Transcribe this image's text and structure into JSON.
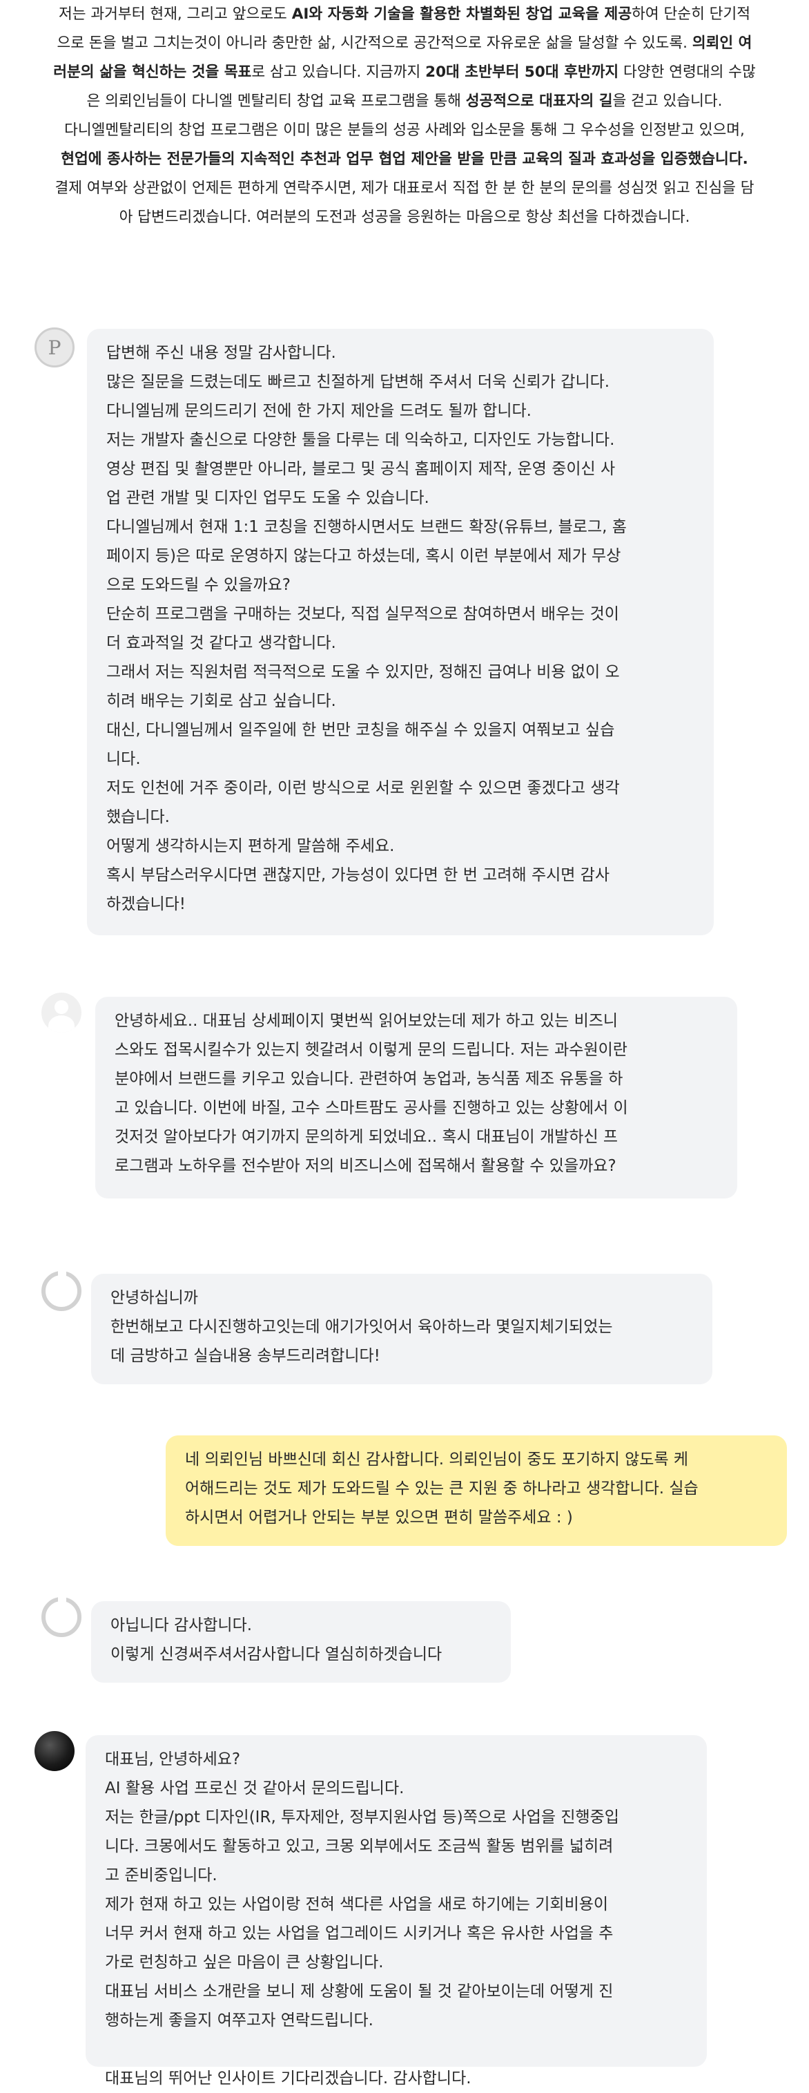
{
  "intro": {
    "lines": [
      [
        {
          "t": "저는 과거부터 현재, 그리고 앞으로도 "
        },
        {
          "t": "AI와 자동화 기술을 활용한 차별화된 창업 교육을 제공",
          "b": true
        },
        {
          "t": "하여 단순히 단기적"
        }
      ],
      [
        {
          "t": "으로 돈을 벌고 그치는것이 아니라 충만한 삶, 시간적으로 공간적으로 자유로운 삶을 달성할 수 있도록. "
        },
        {
          "t": "의뢰인 여",
          "b": true
        }
      ],
      [
        {
          "t": "러분의 삶을 혁신하는 것을 목표",
          "b": true
        },
        {
          "t": "로 삼고 있습니다. 지금까지 "
        },
        {
          "t": "20대 초반부터 50대 후반까지",
          "b": true
        },
        {
          "t": " 다양한 연령대의 수많"
        }
      ],
      [
        {
          "t": "은 의뢰인님들이 다니엘 멘탈리티 창업 교육 프로그램을 통해 "
        },
        {
          "t": "성공적으로 대표자의 길",
          "b": true
        },
        {
          "t": "을 걷고 있습니다."
        }
      ],
      [
        {
          "t": "다니엘멘탈리티의 창업 프로그램은 이미 많은 분들의 성공 사례와 입소문을 통해 그 우수성을 인정받고 있으며,"
        }
      ],
      [
        {
          "t": "현업에 종사하는 전문가들의 지속적인 추천과 업무 협업 제안을 받을 만큼 교육의 질과 효과성을 입증했습니다.",
          "b": true
        }
      ],
      [
        {
          "t": "결제 여부와 상관없이 언제든 편하게 연락주시면, 제가 대표로서 직접 한 분 한 분의 문의를 성심껏 읽고 진심을 담"
        }
      ],
      [
        {
          "t": "아 답변드리겠습니다. 여러분의 도전과 성공을 응원하는 마음으로 항상 최선을 다하겠습니다."
        }
      ]
    ]
  },
  "messages": [
    {
      "avatar": "p-logo-avatar",
      "avatar_letter": "P",
      "lines": [
        "답변해 주신 내용 정말 감사합니다.",
        "많은 질문을 드렸는데도 빠르고 친절하게 답변해 주셔서 더욱 신뢰가 갑니다.",
        "다니엘님께 문의드리기 전에 한 가지 제안을 드려도 될까 합니다.",
        "저는 개발자 출신으로 다양한 툴을 다루는 데 익숙하고, 디자인도 가능합니다.",
        "영상 편집 및 촬영뿐만 아니라, 블로그 및 공식 홈페이지 제작, 운영 중이신 사",
        "업 관련 개발 및 디자인 업무도 도울 수 있습니다.",
        "다니엘님께서 현재 1:1 코칭을 진행하시면서도 브랜드 확장(유튜브, 블로그, 홈",
        "페이지 등)은 따로 운영하지 않는다고 하셨는데, 혹시 이런 부분에서 제가 무상",
        "으로 도와드릴 수 있을까요?",
        "단순히 프로그램을 구매하는 것보다, 직접 실무적으로 참여하면서 배우는 것이",
        "더 효과적일 것 같다고 생각합니다.",
        "그래서 저는 직원처럼 적극적으로 도울 수 있지만, 정해진 급여나 비용 없이 오",
        "히려 배우는 기회로 삼고 싶습니다.",
        "대신, 다니엘님께서 일주일에 한 번만 코칭을 해주실 수 있을지 여쭤보고 싶습",
        "니다.",
        "저도 인천에 거주 중이라, 이런 방식으로 서로 윈윈할 수 있으면 좋겠다고 생각",
        "했습니다.",
        "어떻게 생각하시는지 편하게 말씀해 주세요.",
        "혹시 부담스러우시다면 괜찮지만, 가능성이 있다면 한 번 고려해 주시면 감사",
        "하겠습니다!"
      ]
    },
    {
      "avatar": "default-person-avatar",
      "lines": [
        "안녕하세요.. 대표님 상세페이지 몇번씩 읽어보았는데 제가 하고 있는 비즈니",
        "스와도 접목시킬수가 있는지 헷갈려서 이렇게 문의 드립니다. 저는 과수원이란",
        "분야에서 브랜드를 키우고 있습니다. 관련하여 농업과, 농식품 제조 유통을 하",
        "고 있습니다. 이번에 바질, 고수 스마트팜도 공사를 진행하고 있는 상황에서 이",
        "것저것 알아보다가 여기까지 문의하게 되었네요.. 혹시 대표님이 개발하신 프",
        "로그램과 노하우를 전수받아 저의 비즈니스에 접목해서 활용할 수 있을까요?"
      ]
    },
    {
      "avatar": "ring-avatar",
      "lines": [
        "안녕하십니까",
        "한번해보고 다시진행하고잇는데 애기가잇어서 육아하느라 몇일지체기되었는",
        "데 금방하고 실습내용 송부드리려합니다!"
      ]
    },
    {
      "avatar": "none",
      "mine": true,
      "lines": [
        "네 의뢰인님 바쁘신데 회신 감사합니다. 의뢰인님이 중도 포기하지 않도록 케",
        "어해드리는 것도 제가 도와드릴 수 있는 큰 지원 중 하나라고 생각합니다. 실습",
        "하시면서 어렵거나 안되는 부분 있으면 편히 말씀주세요 : )"
      ]
    },
    {
      "avatar": "ring-avatar",
      "lines": [
        "아닙니다 감사합니다.",
        "이렇게 신경써주셔서감사합니다 열심히하겟습니다"
      ]
    },
    {
      "avatar": "dark-avatar",
      "lines": [
        "대표님, 안녕하세요?",
        "AI 활용 사업 프로신 것 같아서 문의드립니다.",
        "저는 한글/ppt 디자인(IR, 투자제안, 정부지원사업 등)쪽으로 사업을 진행중입",
        "니다. 크몽에서도 활동하고 있고, 크몽 외부에서도 조금씩 활동 범위를 넓히려",
        "고 준비중입니다.",
        "제가 현재 하고 있는 사업이랑 전혀 색다른 사업을 새로 하기에는 기회비용이",
        "너무 커서 현재 하고 있는 사업을 업그레이드 시키거나 혹은 유사한 사업을 추",
        "가로 런칭하고 싶은 마음이 큰 상황입니다.",
        "대표님 서비스 소개란을 보니 제 상황에 도움이 될 것 같아보이는데 어떻게 진",
        "행하는게 좋을지 여쭈고자 연락드립니다.",
        "",
        "대표님의 뛰어난 인사이트 기다리겠습니다. 감사합니다."
      ]
    }
  ]
}
